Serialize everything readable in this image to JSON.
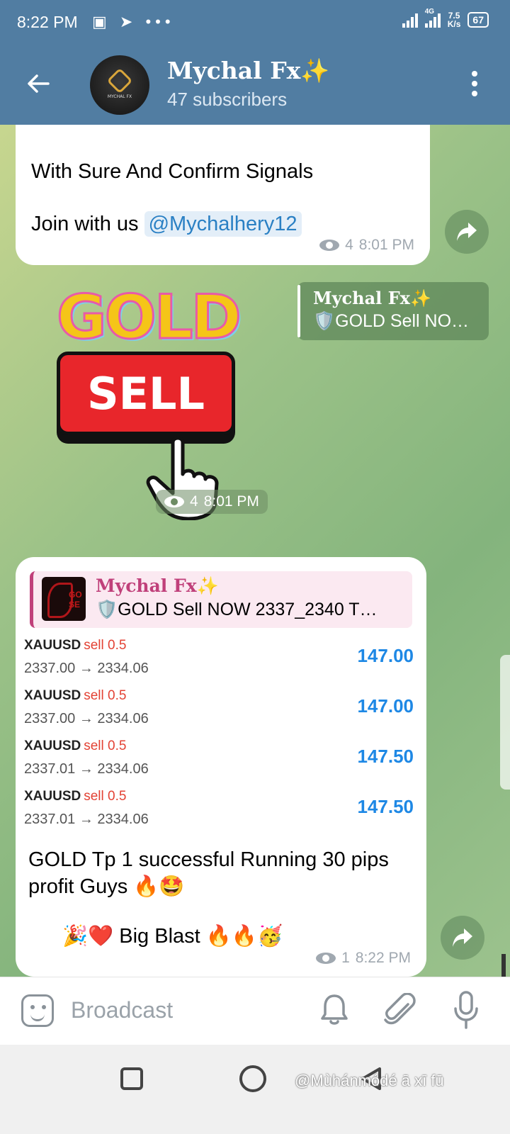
{
  "status_bar": {
    "time": "8:22 PM",
    "network_label": "4G",
    "net_speed_value": "7.5",
    "net_speed_unit": "K/s",
    "battery": "67",
    "left_icons": [
      "notification-icon",
      "telegram-icon",
      "more-dots-icon"
    ]
  },
  "header": {
    "title": "Mychal Fx✨",
    "subtitle": "47 subscribers",
    "avatar_text": "MYCHAL FX"
  },
  "messages": {
    "first": {
      "line1": "With Sure And Confirm Signals",
      "line2_prefix": "Join with us",
      "mention": "@Mychalhery12",
      "views": "4",
      "time": "8:01 PM"
    },
    "sticker": {
      "word1": "GOLD",
      "word2": "SELL",
      "views": "4",
      "time": "8:01 PM",
      "reply_name": "Mychal Fx✨",
      "reply_text": "🛡️GOLD Sell NO…"
    },
    "report": {
      "quote_name": "Mychal Fx✨",
      "quote_text": "🛡️GOLD Sell NOW 2337_2340  T…",
      "trades": [
        {
          "symbol": "XAUUSD",
          "side": "sell 0.5",
          "prices": "2337.00 → 2334.06",
          "profit": "147.00"
        },
        {
          "symbol": "XAUUSD",
          "side": "sell 0.5",
          "prices": "2337.00 → 2334.06",
          "profit": "147.00"
        },
        {
          "symbol": "XAUUSD",
          "side": "sell 0.5",
          "prices": "2337.01 → 2334.06",
          "profit": "147.50"
        },
        {
          "symbol": "XAUUSD",
          "side": "sell 0.5",
          "prices": "2337.01 → 2334.06",
          "profit": "147.50"
        }
      ],
      "text1": " GOLD Tp 1 successful Running 30 pips profit Guys 🔥🤩",
      "text2": "🎉❤️ Big Blast 🔥🔥🥳",
      "views": "1",
      "time": "8:22 PM"
    }
  },
  "composer": {
    "placeholder": "Broadcast"
  },
  "watermark": "@Mùhánmódé ā xī fū",
  "colors": {
    "header_bg": "#517da2",
    "mention": "#2a80c4",
    "profit": "#1e88e5",
    "sell": "#e34234",
    "quote_accent": "#c0407a"
  }
}
